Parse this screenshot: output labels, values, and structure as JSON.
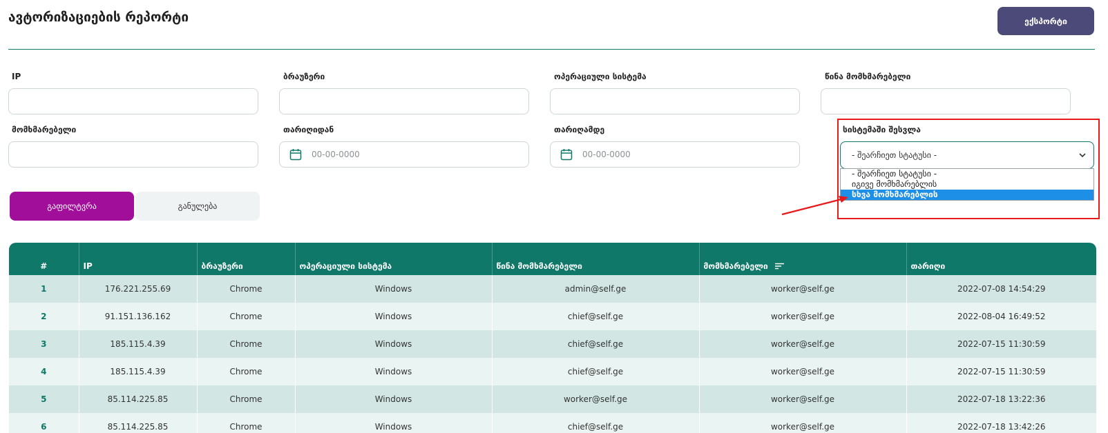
{
  "header": {
    "title": "ავტორიზაციების რეპორტი",
    "export_label": "ექსპორტი"
  },
  "filters": {
    "ip_label": "IP",
    "browser_label": "ბრაუზერი",
    "os_label": "ოპერაციული სისტემა",
    "prev_user_label": "წინა მომხმარებელი",
    "user_label": "მომხმარებელი",
    "date_from_label": "თარიღიდან",
    "date_to_label": "თარიღამდე",
    "date_placeholder": "00-00-0000",
    "login_label": "სისტემაში შესვლა",
    "login_selected": "- შეარჩიეთ სტატუსი -",
    "login_options": [
      "- შეარჩიეთ სტატუსი -",
      "იგივე მომხმარებლის",
      "სხვა მომხმარებლის"
    ]
  },
  "actions": {
    "filter_label": "გაფილტვრა",
    "reset_label": "განულება"
  },
  "table": {
    "columns": [
      "#",
      "IP",
      "ბრაუზერი",
      "ოპერაციული სისტემა",
      "წინა მომხმარებელი",
      "მომხმარებელი",
      "თარიღი"
    ],
    "rows": [
      [
        "1",
        "176.221.255.69",
        "Chrome",
        "Windows",
        "admin@self.ge",
        "worker@self.ge",
        "2022-07-08 14:54:29"
      ],
      [
        "2",
        "91.151.136.162",
        "Chrome",
        "Windows",
        "chief@self.ge",
        "worker@self.ge",
        "2022-08-04 16:49:52"
      ],
      [
        "3",
        "185.115.4.39",
        "Chrome",
        "Windows",
        "chief@self.ge",
        "worker@self.ge",
        "2022-07-15 11:30:59"
      ],
      [
        "4",
        "185.115.4.39",
        "Chrome",
        "Windows",
        "chief@self.ge",
        "worker@self.ge",
        "2022-07-15 11:30:59"
      ],
      [
        "5",
        "85.114.225.85",
        "Chrome",
        "Windows",
        "worker@self.ge",
        "worker@self.ge",
        "2022-07-18 13:22:36"
      ],
      [
        "6",
        "85.114.225.85",
        "Chrome",
        "Windows",
        "chief@self.ge",
        "worker@self.ge",
        "2022-07-18 13:42:26"
      ]
    ]
  },
  "colors": {
    "brand_green": "#0f7868",
    "filter_purple": "#a10f9a",
    "export_indigo": "#4b4a78",
    "highlight_red": "#e81919",
    "option_blue": "#1e8fe6"
  },
  "icons": {
    "date": "calendar-icon",
    "select": "chevron-down-icon",
    "sort": "sort-icon"
  }
}
